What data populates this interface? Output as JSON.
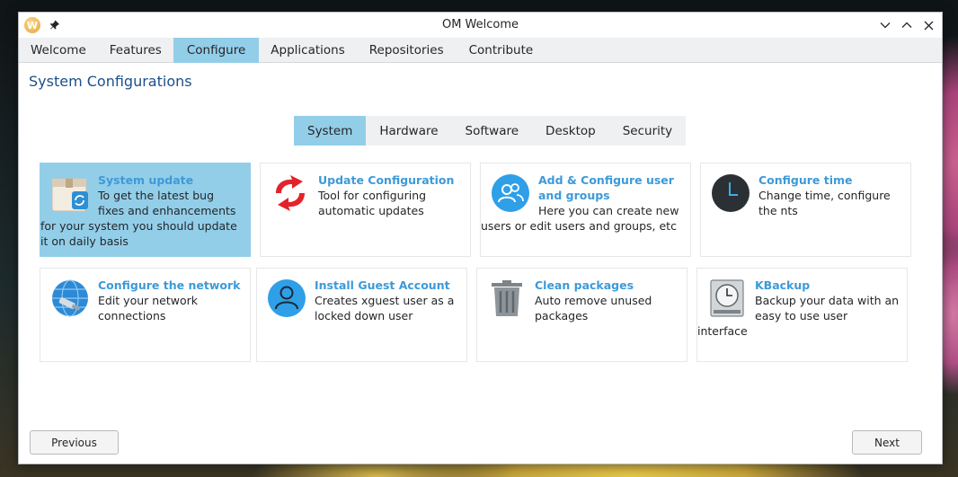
{
  "window": {
    "title": "OM Welcome",
    "app_icon_letter": "W"
  },
  "tabs": [
    {
      "label": "Welcome",
      "active": false
    },
    {
      "label": "Features",
      "active": false
    },
    {
      "label": "Configure",
      "active": true
    },
    {
      "label": "Applications",
      "active": false
    },
    {
      "label": "Repositories",
      "active": false
    },
    {
      "label": "Contribute",
      "active": false
    }
  ],
  "section_title": "System Configurations",
  "subtabs": [
    {
      "label": "System",
      "active": true
    },
    {
      "label": "Hardware",
      "active": false
    },
    {
      "label": "Software",
      "active": false
    },
    {
      "label": "Desktop",
      "active": false
    },
    {
      "label": "Security",
      "active": false
    }
  ],
  "cards": [
    {
      "title": "System update",
      "desc": "To get the latest bug fixes and enhancements for your system you should update it on daily basis",
      "icon": "package-update-icon",
      "selected": true
    },
    {
      "title": "Update Configuration",
      "desc": "Tool for configuring automatic updates",
      "icon": "update-config-icon",
      "selected": false
    },
    {
      "title": "Add & Configure user and groups",
      "desc": "Here you can create new users or edit users and groups, etc",
      "icon": "users-icon",
      "selected": false
    },
    {
      "title": "Configure time",
      "desc": "Change time, configure the nts",
      "icon": "clock-icon",
      "selected": false
    },
    {
      "title": "Configure the network",
      "desc": "Edit your network connections",
      "icon": "network-globe-icon",
      "selected": false
    },
    {
      "title": "Install Guest Account",
      "desc": "Creates xguest user as a locked down user",
      "icon": "guest-user-icon",
      "selected": false
    },
    {
      "title": "Clean packages",
      "desc": "Auto remove unused packages",
      "icon": "trash-icon",
      "selected": false
    },
    {
      "title": "KBackup",
      "desc": "Backup your data with an easy to use user interface",
      "icon": "backup-drive-icon",
      "selected": false
    }
  ],
  "buttons": {
    "previous": "Previous",
    "next": "Next"
  },
  "colors": {
    "accent": "#93cee9",
    "card_title": "#3d9ad8",
    "section_title": "#1d4f8a"
  }
}
